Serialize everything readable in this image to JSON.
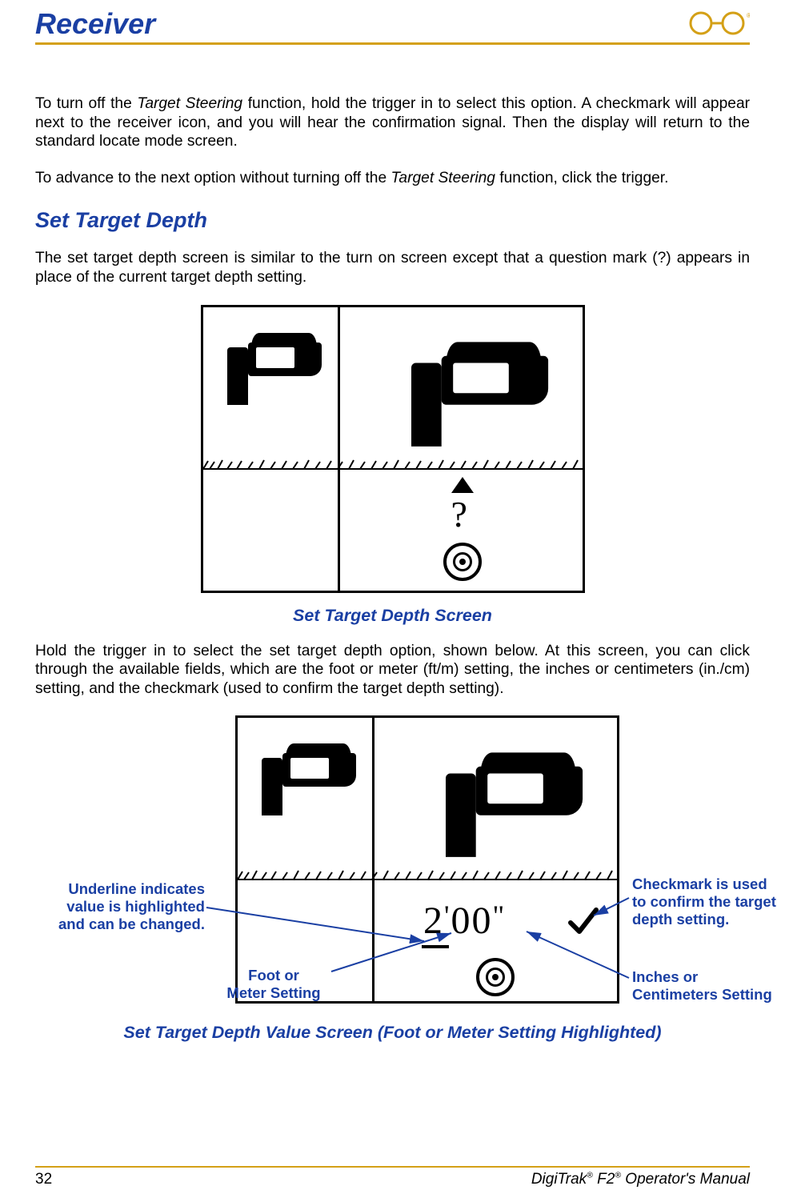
{
  "header": {
    "section_title": "Receiver"
  },
  "para1_a": "To turn off the ",
  "para1_b": "Target Steering",
  "para1_c": " function, hold the trigger in to select this option. A checkmark will appear next to the receiver icon, and you will hear the confirmation signal. Then the display will return to the standard locate mode screen.",
  "para2_a": "To advance to the next option without turning off the ",
  "para2_b": "Target Steering",
  "para2_c": " function, click the trigger.",
  "h2": "Set Target Depth",
  "para3": "The set target depth screen is similar to the turn on screen except that a question mark (?) appears in place of the current target depth setting.",
  "fig1": {
    "caption": "Set Target Depth Screen",
    "question_mark": "?"
  },
  "para4": "Hold the trigger in to select the set target depth option, shown below. At this screen, you can click through the available fields, which are the foot or meter (ft/m) setting, the inches or centimeters (in./cm) setting, and the checkmark (used to confirm the target depth setting).",
  "fig2": {
    "caption": "Set Target Depth Value Screen (Foot or Meter Setting Highlighted)",
    "value_feet": "2",
    "value_feet_mark": "'",
    "value_inches": "00",
    "value_inches_mark": "\"",
    "anno_underline": "Underline indicates\nvalue is highlighted\nand can be changed.",
    "anno_footmeter": "Foot or\nMeter Setting",
    "anno_checkmark": "Checkmark is used\nto confirm the target\ndepth setting.",
    "anno_inches": "Inches or\nCentimeters Setting"
  },
  "footer": {
    "page_number": "32",
    "product_a": "DigiTrak",
    "product_b": " F2",
    "product_c": " Operator's Manual",
    "reg": "®"
  }
}
